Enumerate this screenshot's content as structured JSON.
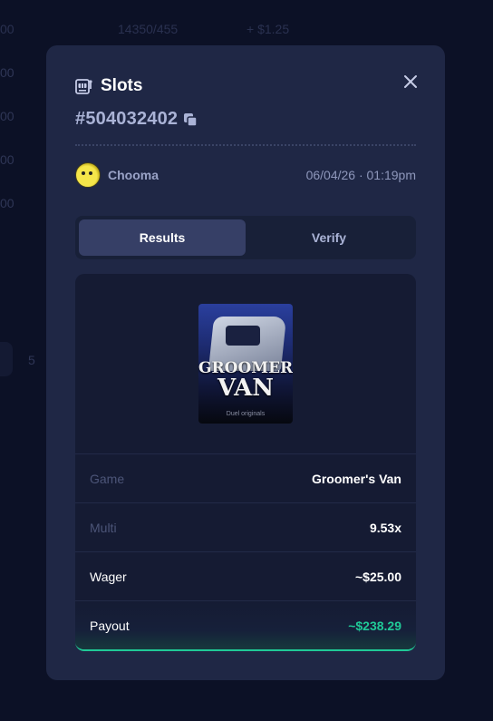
{
  "background": {
    "page_number": "5",
    "left_values": [
      "00",
      "00",
      "00",
      "00",
      "00"
    ],
    "top_text": [
      "14350/455",
      "+ $1.25"
    ]
  },
  "modal": {
    "title": "Slots",
    "bet_id": "#504032402",
    "user": {
      "name": "Chooma"
    },
    "timestamp": "06/04/26 · 01:19pm",
    "tabs": [
      {
        "label": "Results",
        "active": true
      },
      {
        "label": "Verify",
        "active": false
      }
    ],
    "game_thumbnail": {
      "title_line1": "GROOMER'S",
      "title_line2": "VAN",
      "subtitle": "Duel originals"
    },
    "details": [
      {
        "label": "Game",
        "value": "Groomer's Van"
      },
      {
        "label": "Multi",
        "value": "9.53x"
      },
      {
        "label": "Wager",
        "value": "~$25.00"
      },
      {
        "label": "Payout",
        "value": "~$238.29"
      }
    ]
  },
  "colors": {
    "modal_bg": "#1f2745",
    "panel_bg": "#151b33",
    "accent_green": "#20c997",
    "active_tab": "#363f66"
  },
  "icons": {
    "title": "slot-machine-icon",
    "copy": "copy-icon",
    "close": "close-icon"
  }
}
